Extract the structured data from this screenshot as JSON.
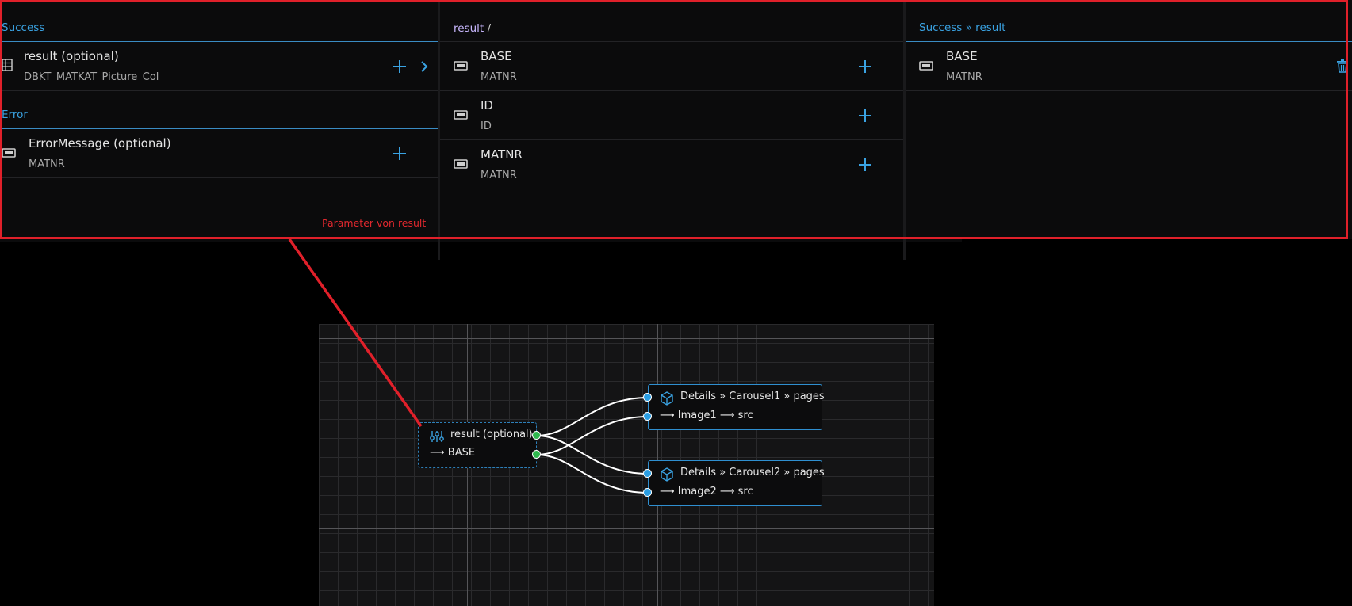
{
  "left_panel": {
    "success_header": "Success",
    "success_row": {
      "title": "result (optional)",
      "subtitle": "DBKT_MATKAT_Picture_Col"
    },
    "error_header": "Error",
    "error_row": {
      "title": "ErrorMessage (optional)",
      "subtitle": "MATNR"
    },
    "annotation": "Parameter von result"
  },
  "middle_panel": {
    "breadcrumb_link": "result",
    "breadcrumb_sep": "/",
    "rows": [
      {
        "title": "BASE",
        "subtitle": "MATNR"
      },
      {
        "title": "ID",
        "subtitle": "ID"
      },
      {
        "title": "MATNR",
        "subtitle": "MATNR"
      }
    ]
  },
  "right_panel": {
    "header": "Success » result",
    "row": {
      "title": "BASE",
      "subtitle": "MATNR"
    }
  },
  "canvas": {
    "source_node": {
      "title": "result (optional)",
      "field": "⟶ BASE"
    },
    "target_nodes": [
      {
        "title": "Details » Carousel1 » pages",
        "field": "⟶ Image1 ⟶ src"
      },
      {
        "title": "Details » Carousel2 » pages",
        "field": "⟶ Image2 ⟶ src"
      }
    ]
  },
  "colors": {
    "accent": "#3aa3e3",
    "highlight": "#e0202a",
    "port_source": "#2fb84e",
    "port_target": "#2a9ee3"
  }
}
